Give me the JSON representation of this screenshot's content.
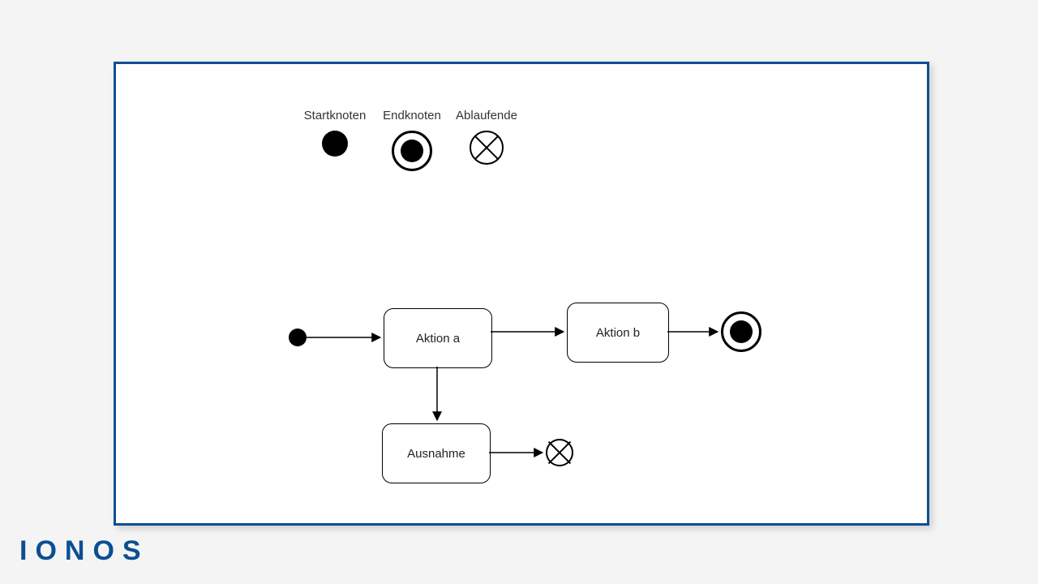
{
  "logo": "IONOS",
  "legend": {
    "start": "Startknoten",
    "end": "Endknoten",
    "flowend": "Ablaufende"
  },
  "nodes": {
    "actionA": "Aktion a",
    "actionB": "Aktion b",
    "exception": "Ausnahme"
  }
}
